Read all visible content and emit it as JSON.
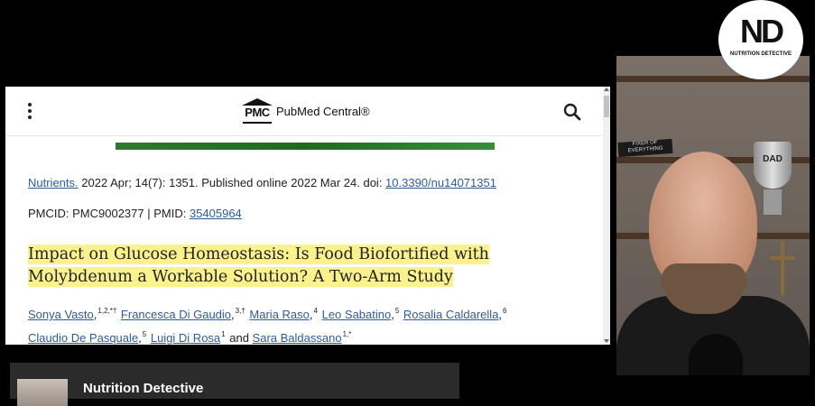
{
  "header": {
    "logo_mark": "PMC",
    "logo_name": "PubMed Central®"
  },
  "citation": {
    "journal": "Nutrients.",
    "text": " 2022 Apr; 14(7): 1351.  Published online 2022 Mar 24. doi: ",
    "doi": "10.3390/nu14071351"
  },
  "ids": {
    "pmcid_text": "PMCID: PMC9002377 | PMID: ",
    "pmid": "35405964"
  },
  "article": {
    "title": "Impact on Glucose Homeostasis: Is Food Biofortified with Molybdenum a Workable Solution? A Two-Arm Study"
  },
  "authors": [
    {
      "name": "Sonya Vasto",
      "sup": "1,2,*†",
      "sep": " "
    },
    {
      "name": "Francesca Di Gaudio",
      "sup": "3,†",
      "sep": " "
    },
    {
      "name": "Maria Raso",
      "sup": "4",
      "sep": " "
    },
    {
      "name": "Leo Sabatino",
      "sup": "5",
      "sep": " "
    },
    {
      "name": "Rosalia Caldarella",
      "sup": "6",
      "sep": " "
    },
    {
      "name": "Claudio De Pasquale",
      "sup": "5",
      "sep": " "
    },
    {
      "name": "Luigi Di Rosa",
      "sup": "1",
      "sep": " and "
    },
    {
      "name": "Sara Baldassano",
      "sup": "1,*",
      "sep": ""
    }
  ],
  "webcam": {
    "sign_text": "FIXER OF EVERYTHING",
    "trophy_text": "DAD"
  },
  "badge": {
    "initials": "ND",
    "caption": "NUTRITION DETECTIVE"
  },
  "channel": {
    "name": "Nutrition Detective"
  },
  "colors": {
    "highlight": "#fbf28e",
    "link": "#2e5c9a",
    "green_bar": "#2f7a2f"
  }
}
